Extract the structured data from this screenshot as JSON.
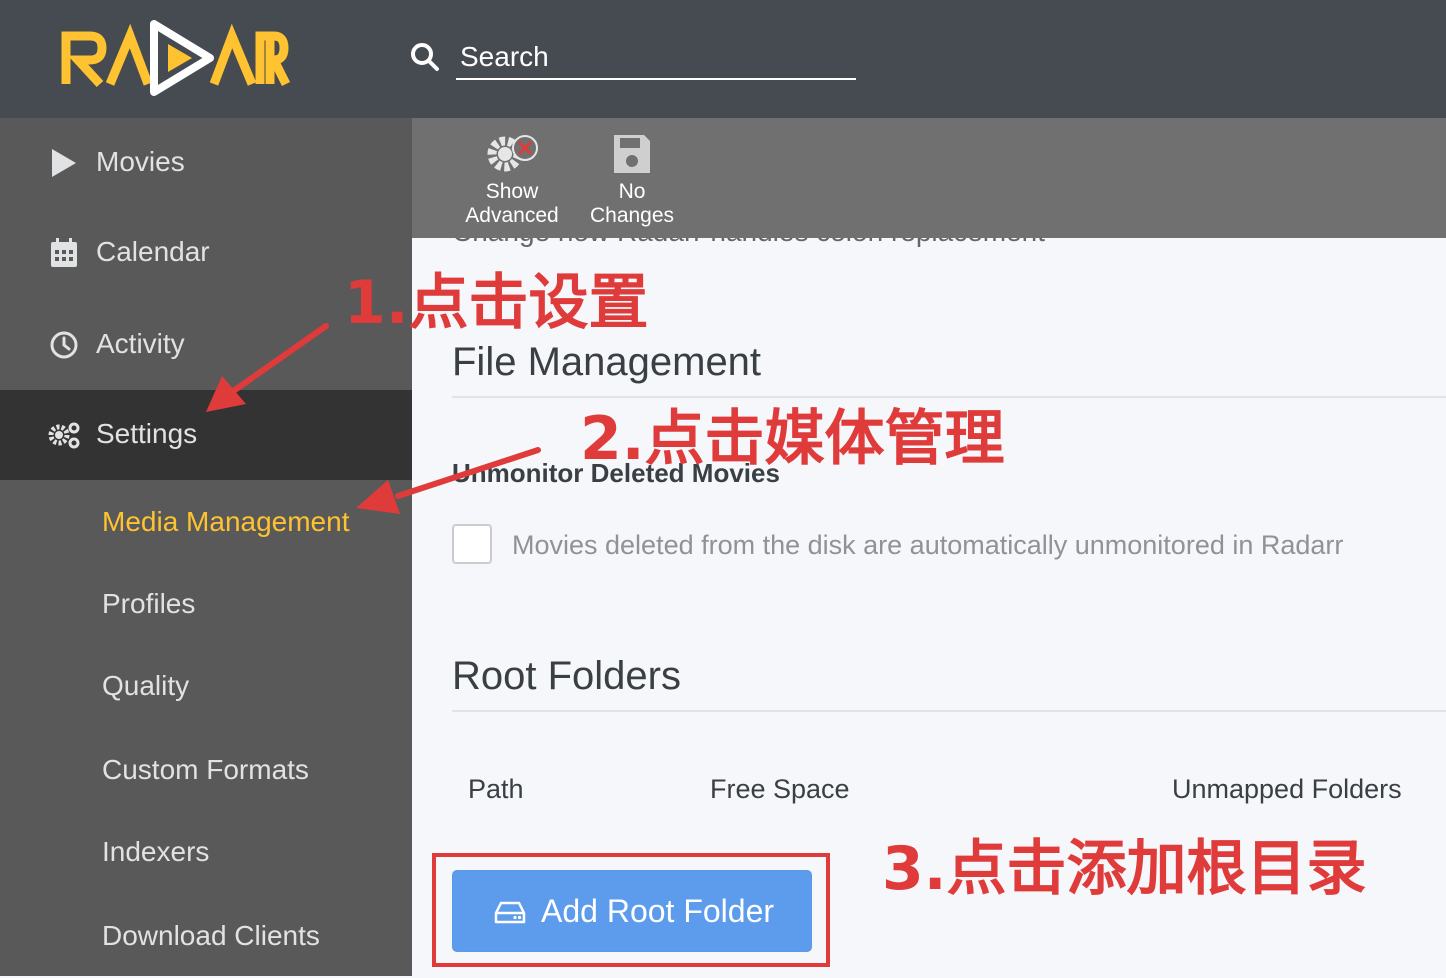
{
  "header": {
    "logo_text": "RADARR",
    "search": {
      "placeholder": "Search"
    }
  },
  "sidebar": {
    "items": [
      {
        "label": "Movies",
        "icon": "play-icon"
      },
      {
        "label": "Calendar",
        "icon": "calendar-icon"
      },
      {
        "label": "Activity",
        "icon": "clock-icon"
      },
      {
        "label": "Settings",
        "icon": "gears-icon",
        "active": true
      }
    ],
    "subitems": [
      {
        "label": "Media Management",
        "active": true
      },
      {
        "label": "Profiles"
      },
      {
        "label": "Quality"
      },
      {
        "label": "Custom Formats"
      },
      {
        "label": "Indexers"
      },
      {
        "label": "Download Clients"
      }
    ]
  },
  "toolbar": {
    "show_advanced": {
      "line1": "Show",
      "line2": "Advanced",
      "icon": "advanced-settings-icon"
    },
    "no_changes": {
      "line1": "No",
      "line2": "Changes",
      "icon": "save-icon"
    }
  },
  "main": {
    "cut_off_text": "Change how Radarr handles colon replacement",
    "file_management": {
      "title": "File Management",
      "field_label": "Unmonitor Deleted Movies",
      "help_text": "Movies deleted from the disk are automatically unmonitored in Radarr",
      "checked": false
    },
    "root_folders": {
      "title": "Root Folders",
      "columns": [
        "Path",
        "Free Space",
        "Unmapped Folders"
      ],
      "add_button": "Add Root Folder",
      "add_icon": "drive-icon"
    }
  },
  "annotations": {
    "step1": "1.点击设置",
    "step2": "2.点击媒体管理",
    "step3": "3.点击添加根目录"
  },
  "colors": {
    "header_bg": "#464b51",
    "sidebar_bg": "#595959",
    "active_bg": "#333333",
    "accent": "#ffc230",
    "button_blue": "#5d9cec",
    "annotation_red": "#e03b3b"
  }
}
